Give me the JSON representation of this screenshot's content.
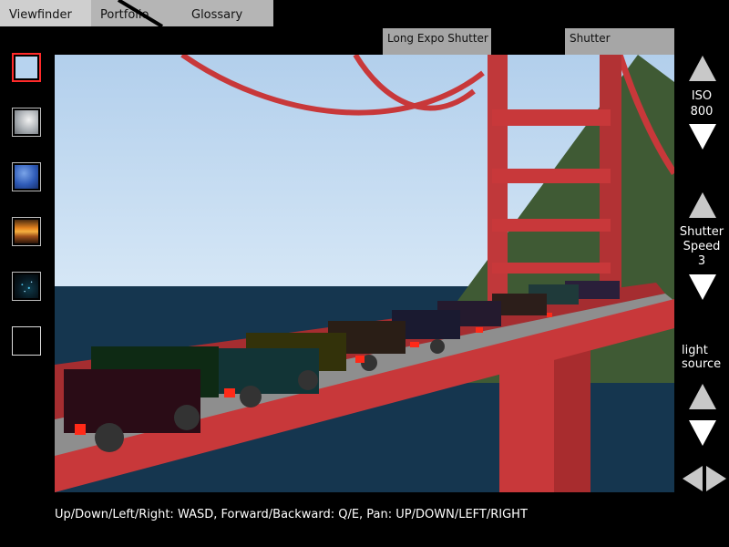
{
  "tabs": [
    {
      "label": "Viewfinder",
      "active": true
    },
    {
      "label": "Portfolio",
      "active": false
    },
    {
      "label": "Glossary",
      "active": false
    }
  ],
  "mode_buttons": {
    "long_expo": "Long Expo Shutter",
    "shutter": "Shutter"
  },
  "swatches": [
    {
      "name": "clear-sky",
      "selected": true
    },
    {
      "name": "overcast-clouds",
      "selected": false
    },
    {
      "name": "blue-sky",
      "selected": false
    },
    {
      "name": "sunset",
      "selected": false
    },
    {
      "name": "night",
      "selected": false
    },
    {
      "name": "blank",
      "selected": false
    }
  ],
  "controls": {
    "iso": {
      "label": "ISO",
      "value": "800"
    },
    "shutter_speed": {
      "label_line1": "Shutter",
      "label_line2": "Speed",
      "value": "3"
    },
    "light_source": {
      "label_line1": "light",
      "label_line2": "source"
    }
  },
  "hint_text": "Up/Down/Left/Right: WASD, Forward/Backward: Q/E, Pan: UP/DOWN/LEFT/RIGHT",
  "colors": {
    "sky": "#cde0f2",
    "water": "#15364f",
    "bridge": "#c8383a",
    "hill": "#3f5a34",
    "selected_border": "#ff2a2a",
    "arrow": "#ffffff"
  }
}
